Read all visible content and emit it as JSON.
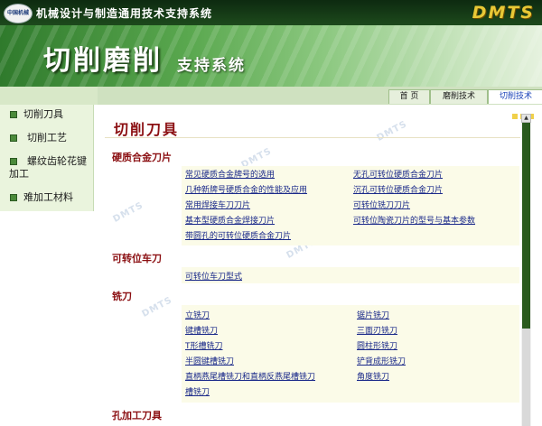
{
  "header": {
    "logo_text": "中国机械",
    "title": "机械设计与制造通用技术支持系统",
    "brand": "DMTS"
  },
  "banner": {
    "title": "切削磨削",
    "subtitle": "支持系统"
  },
  "sidebar": {
    "items": [
      {
        "label": "切削刀具"
      },
      {
        "label": "切削工艺"
      },
      {
        "label": "螺纹齿轮花键加工"
      },
      {
        "label": "难加工材料"
      }
    ]
  },
  "tabs": [
    {
      "label": "首 页"
    },
    {
      "label": "磨削技术"
    },
    {
      "label": "切削技术"
    }
  ],
  "watermark": "DMTS",
  "main": {
    "page_title": "切削刀具",
    "sections": [
      {
        "title": "硬质合金刀片",
        "links": [
          "常见硬质合金牌号的选用",
          "无孔可转位硬质合金刀片",
          "几种新牌号硬质合金的性能及应用",
          "沉孔可转位硬质合金刀片",
          "常用焊接车刀刀片",
          "可转位铣刀刀片",
          "基本型硬质合金焊接刀片",
          "可转位陶瓷刀片的型号与基本参数",
          "带圆孔的可转位硬质合金刀片"
        ]
      },
      {
        "title": "可转位车刀",
        "links": [
          "可转位车刀型式"
        ]
      },
      {
        "title": "铣刀",
        "links": [
          "立铣刀",
          "锯片铣刀",
          "键槽铣刀",
          "三面刃铣刀",
          "T形槽铣刀",
          "圆柱形铣刀",
          "半圆键槽铣刀",
          "铲背成形铣刀",
          "直柄燕尾槽铣刀和直柄反燕尾槽铣刀",
          "角度铣刀",
          "槽铣刀"
        ]
      },
      {
        "title": "孔加工刀具",
        "links": []
      }
    ]
  },
  "scrollbar": {
    "up_arrow": "▲"
  }
}
